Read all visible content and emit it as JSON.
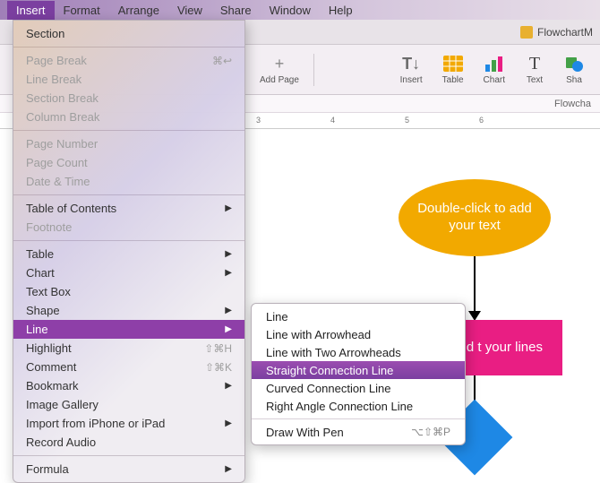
{
  "menubar": {
    "items": [
      "Insert",
      "Format",
      "Arrange",
      "View",
      "Share",
      "Window",
      "Help"
    ],
    "active_index": 0
  },
  "window": {
    "doc_title": "FlowchartM",
    "subtitle": "Flowcha"
  },
  "toolbar": {
    "addpage": "Add Page",
    "insert": "Insert",
    "table": "Table",
    "chart": "Chart",
    "text": "Text",
    "shape": "Sha",
    "plus": "+",
    "insert_glyph": "T↓",
    "table_glyph": "",
    "chart_glyph": "",
    "text_glyph": "T",
    "shape_glyph": ""
  },
  "ruler": {
    "ticks": [
      "3",
      "4",
      "5",
      "6"
    ]
  },
  "canvas": {
    "ellipse_text": "Double-click to add your text",
    "rect_text": "r shape and t your lines"
  },
  "insert_menu": {
    "items": [
      {
        "label": "Section",
        "enabled": true
      },
      {
        "sep": true
      },
      {
        "label": "Page Break",
        "enabled": false,
        "sc": "⌘↩"
      },
      {
        "label": "Line Break",
        "enabled": false
      },
      {
        "label": "Section Break",
        "enabled": false
      },
      {
        "label": "Column Break",
        "enabled": false
      },
      {
        "sep": true
      },
      {
        "label": "Page Number",
        "enabled": false
      },
      {
        "label": "Page Count",
        "enabled": false
      },
      {
        "label": "Date & Time",
        "enabled": false
      },
      {
        "sep": true
      },
      {
        "label": "Table of Contents",
        "enabled": true,
        "sub": true
      },
      {
        "label": "Footnote",
        "enabled": false
      },
      {
        "sep": true
      },
      {
        "label": "Table",
        "enabled": true,
        "sub": true
      },
      {
        "label": "Chart",
        "enabled": true,
        "sub": true
      },
      {
        "label": "Text Box",
        "enabled": true
      },
      {
        "label": "Shape",
        "enabled": true,
        "sub": true
      },
      {
        "label": "Line",
        "enabled": true,
        "sub": true,
        "selected": true
      },
      {
        "label": "Highlight",
        "enabled": true,
        "sc": "⇧⌘H"
      },
      {
        "label": "Comment",
        "enabled": true,
        "sc": "⇧⌘K"
      },
      {
        "label": "Bookmark",
        "enabled": true,
        "sub": true
      },
      {
        "label": "Image Gallery",
        "enabled": true
      },
      {
        "label": "Import from iPhone or iPad",
        "enabled": true,
        "sub": true
      },
      {
        "label": "Record Audio",
        "enabled": true
      },
      {
        "sep": true
      },
      {
        "label": "Formula",
        "enabled": true,
        "sub": true
      }
    ]
  },
  "line_submenu": {
    "items": [
      {
        "label": "Line"
      },
      {
        "label": "Line with Arrowhead"
      },
      {
        "label": "Line with Two Arrowheads"
      },
      {
        "label": "Straight Connection Line",
        "selected": true
      },
      {
        "label": "Curved Connection Line"
      },
      {
        "label": "Right Angle Connection Line"
      },
      {
        "sep": true
      },
      {
        "label": "Draw With Pen",
        "sc": "⌥⇧⌘P"
      }
    ]
  }
}
